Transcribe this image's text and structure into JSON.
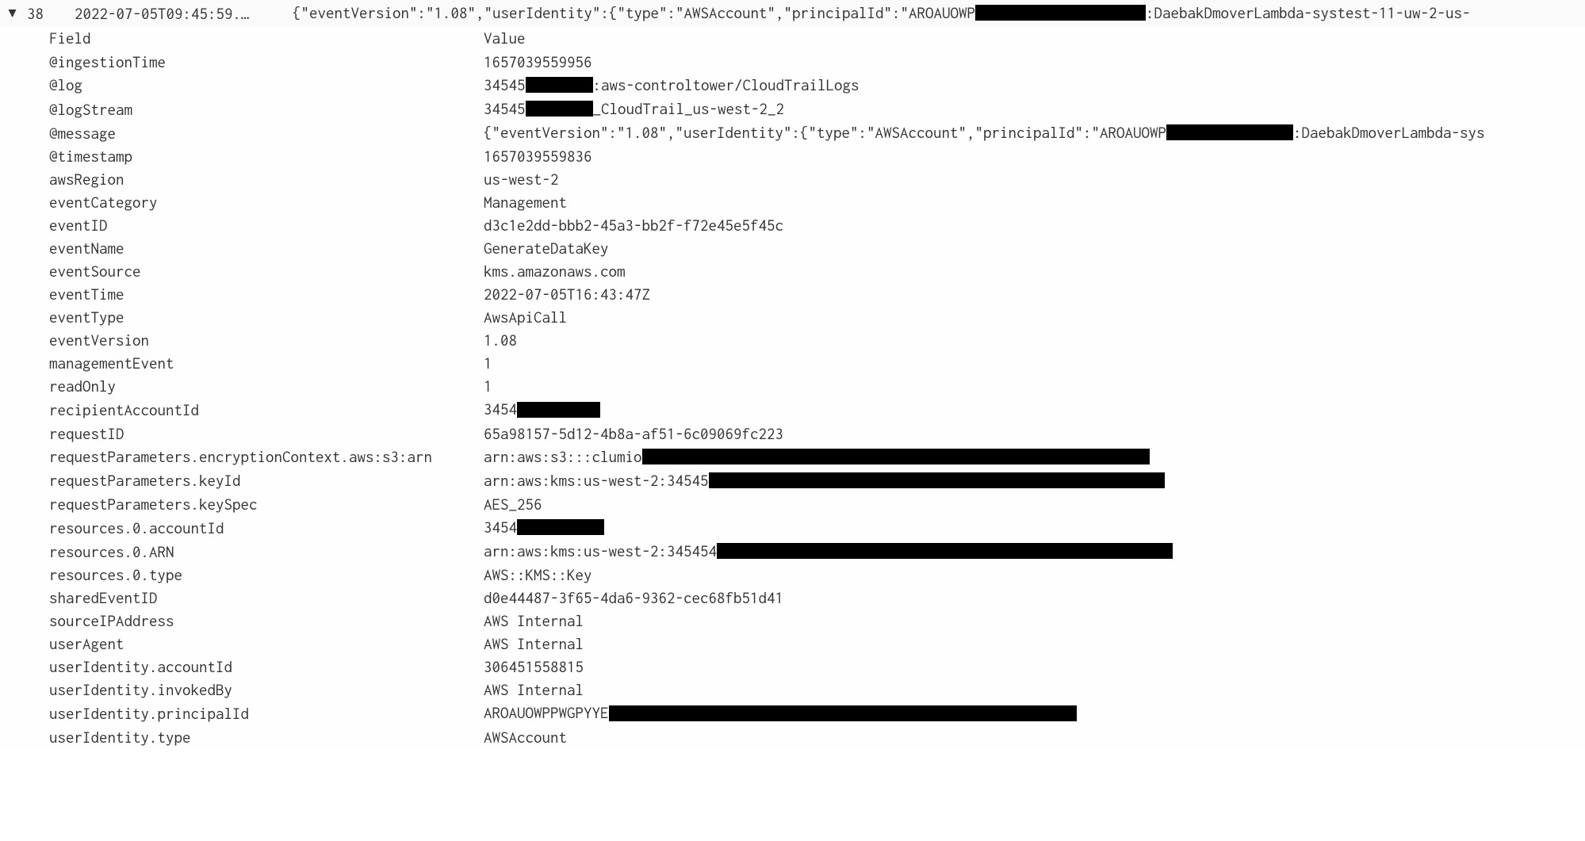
{
  "header": {
    "row_number": "38",
    "timestamp": "2022-07-05T09:45:59.…",
    "message_prefix": "{\"eventVersion\":\"1.08\",\"userIdentity\":{\"type\":\"AWSAccount\",\"principalId\":\"AROAUOWP",
    "message_suffix": ":DaebakDmoverLambda-systest-11-uw-2-us-"
  },
  "columns": {
    "field": "Field",
    "value": "Value"
  },
  "fields": {
    "ingestionTime": {
      "field": "@ingestionTime",
      "value": "1657039559956"
    },
    "log": {
      "field": "@log",
      "value_prefix": "34545",
      "value_suffix": ":aws-controltower/CloudTrailLogs"
    },
    "logStream": {
      "field": "@logStream",
      "value_prefix": "34545",
      "value_suffix": "_CloudTrail_us-west-2_2"
    },
    "message": {
      "field": "@message",
      "value_prefix": "{\"eventVersion\":\"1.08\",\"userIdentity\":{\"type\":\"AWSAccount\",\"principalId\":\"AROAUOWP",
      "value_suffix": ":DaebakDmoverLambda-sys"
    },
    "timestamp": {
      "field": "@timestamp",
      "value": "1657039559836"
    },
    "awsRegion": {
      "field": "awsRegion",
      "value": "us-west-2"
    },
    "eventCategory": {
      "field": "eventCategory",
      "value": "Management"
    },
    "eventID": {
      "field": "eventID",
      "value": "d3c1e2dd-bbb2-45a3-bb2f-f72e45e5f45c"
    },
    "eventName": {
      "field": "eventName",
      "value": "GenerateDataKey"
    },
    "eventSource": {
      "field": "eventSource",
      "value": "kms.amazonaws.com"
    },
    "eventTime": {
      "field": "eventTime",
      "value": "2022-07-05T16:43:47Z"
    },
    "eventType": {
      "field": "eventType",
      "value": "AwsApiCall"
    },
    "eventVersion": {
      "field": "eventVersion",
      "value": "1.08"
    },
    "managementEvent": {
      "field": "managementEvent",
      "value": "1"
    },
    "readOnly": {
      "field": "readOnly",
      "value": "1"
    },
    "recipientAccountId": {
      "field": "recipientAccountId",
      "value_prefix": "3454"
    },
    "requestID": {
      "field": "requestID",
      "value": "65a98157-5d12-4b8a-af51-6c09069fc223"
    },
    "requestParamsS3Arn": {
      "field": "requestParameters.encryptionContext.aws:s3:arn",
      "value_prefix": "arn:aws:s3:::clumio"
    },
    "requestParamsKeyId": {
      "field": "requestParameters.keyId",
      "value_prefix": "arn:aws:kms:us-west-2:34545"
    },
    "requestParamsKeySpec": {
      "field": "requestParameters.keySpec",
      "value": "AES_256"
    },
    "resourcesAccountId": {
      "field": "resources.0.accountId",
      "value_prefix": "3454"
    },
    "resourcesARN": {
      "field": "resources.0.ARN",
      "value_prefix": "arn:aws:kms:us-west-2:345454"
    },
    "resourcesType": {
      "field": "resources.0.type",
      "value": "AWS::KMS::Key"
    },
    "sharedEventID": {
      "field": "sharedEventID",
      "value": "d0e44487-3f65-4da6-9362-cec68fb51d41"
    },
    "sourceIPAddress": {
      "field": "sourceIPAddress",
      "value": "AWS Internal"
    },
    "userAgent": {
      "field": "userAgent",
      "value": "AWS Internal"
    },
    "userIdentityAccountId": {
      "field": "userIdentity.accountId",
      "value": "306451558815"
    },
    "userIdentityInvokedBy": {
      "field": "userIdentity.invokedBy",
      "value": "AWS Internal"
    },
    "userIdentityPrincipalId": {
      "field": "userIdentity.principalId",
      "value_prefix": "AROAUOWPPWGPYYE"
    },
    "userIdentityType": {
      "field": "userIdentity.type",
      "value": "AWSAccount"
    }
  }
}
